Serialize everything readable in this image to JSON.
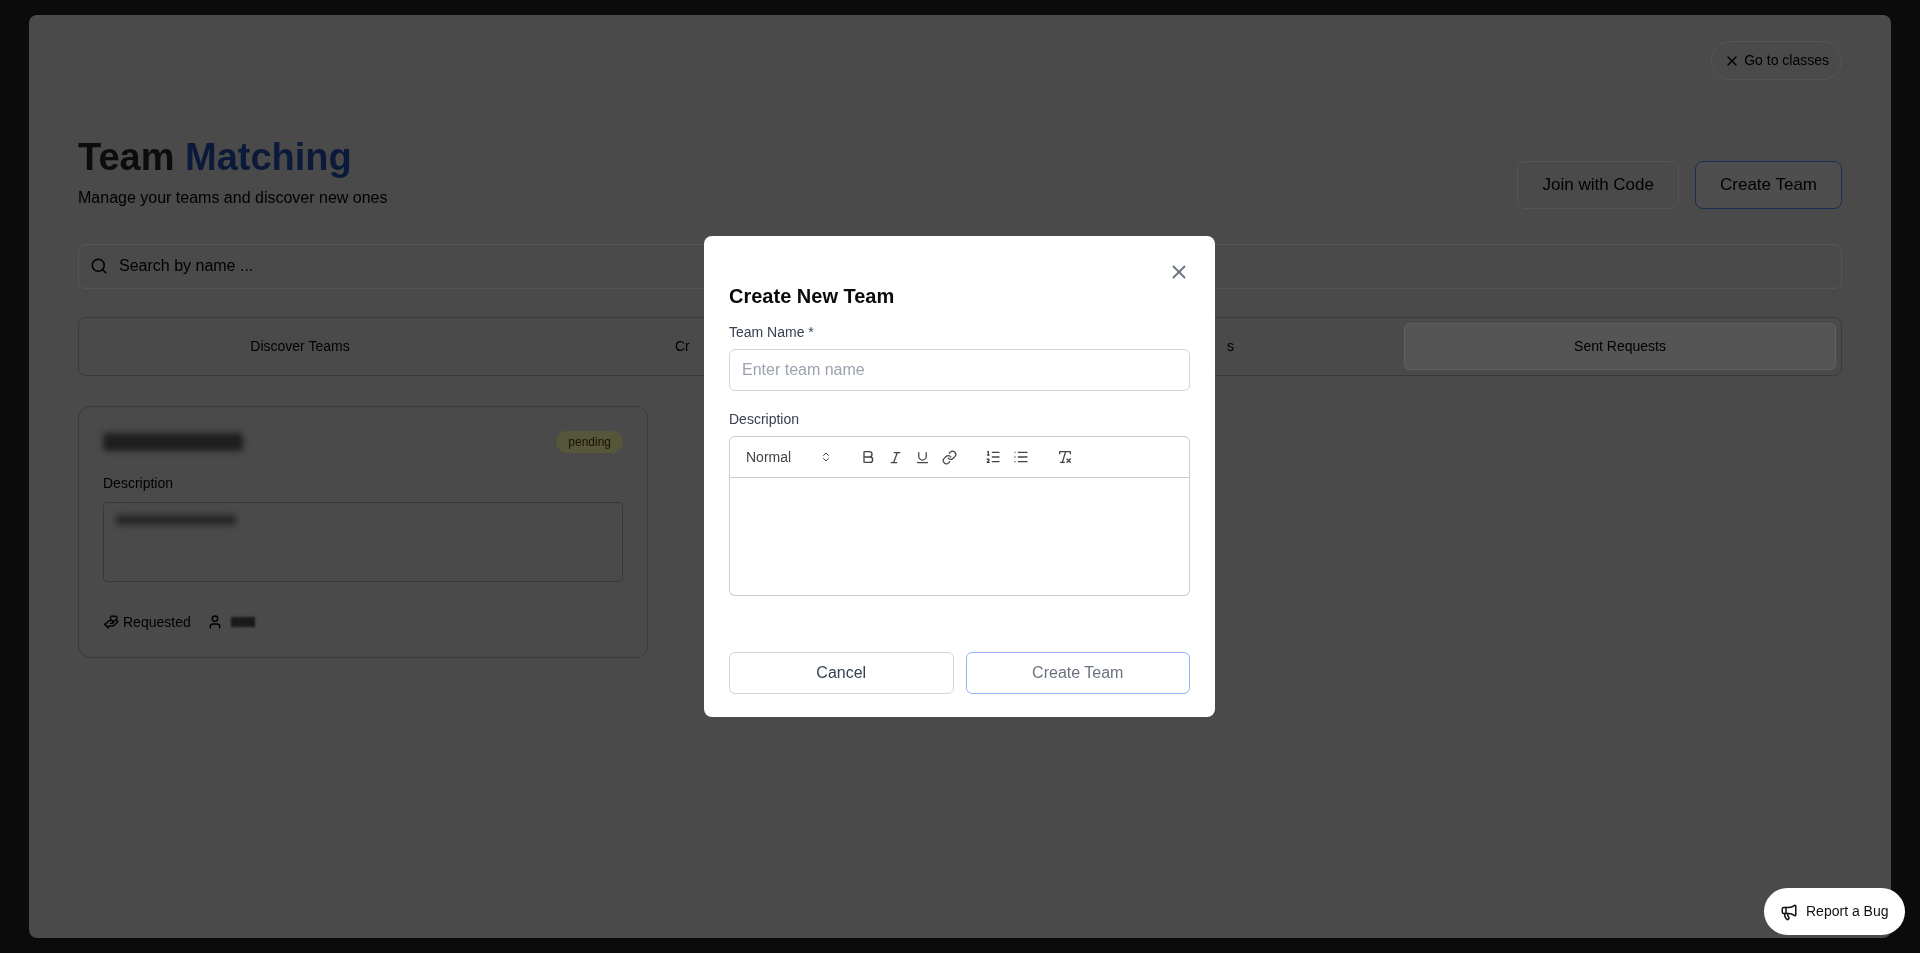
{
  "close_link": "Go to classes",
  "header": {
    "title": "Team",
    "title_highlight": "Matching",
    "subtitle": "Manage your teams and discover new ones"
  },
  "actions": [
    {
      "label": "Join with Code",
      "kind": "outline"
    },
    {
      "label": "Create Team",
      "kind": "primary"
    }
  ],
  "search": {
    "placeholder": "Search by name ..."
  },
  "tabs": [
    {
      "label": "Discover Teams",
      "selected": false
    },
    {
      "label": "Cr",
      "selected": false
    },
    {
      "label": "s",
      "selected": false
    },
    {
      "label": "Sent Requests",
      "selected": true
    }
  ],
  "card": {
    "status": "pending",
    "description_label": "Description",
    "request_state": "Requested"
  },
  "modal": {
    "title": "Create New Team",
    "name_label": "Team Name *",
    "name_placeholder": "Enter team name",
    "description_label": "Description",
    "format": "Normal",
    "buttons": [
      {
        "label": "Cancel",
        "kind": "secondary",
        "disabled": false
      },
      {
        "label": "Create Team",
        "kind": "primary",
        "disabled": true
      }
    ]
  },
  "report_button": "Report a Bug"
}
